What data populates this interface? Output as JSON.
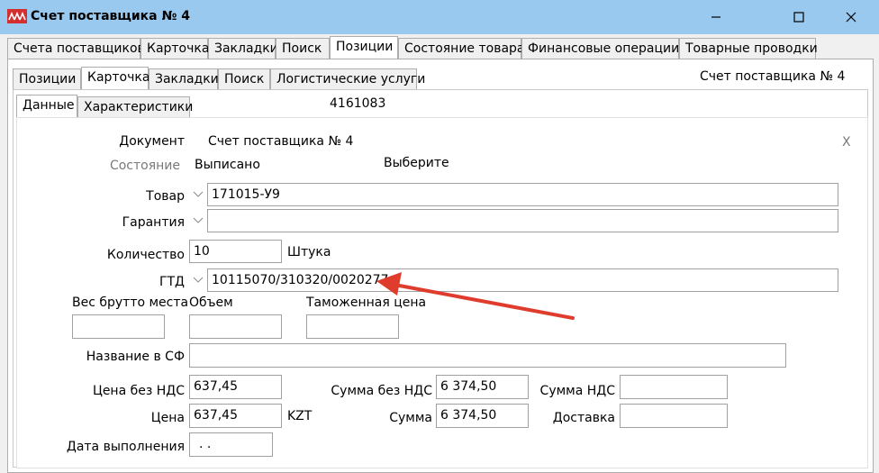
{
  "window": {
    "title": "Счет поставщика № 4",
    "logo_text": "AAA",
    "logo_color": "#d32f2f",
    "minimize_icon": "minimize-icon",
    "maximize_icon": "maximize-icon",
    "close_icon": "close-icon"
  },
  "tabs_top": [
    "Счета поставщиков",
    "Карточка",
    "Закладки",
    "Поиск",
    "Позиции",
    "Состояние товара",
    "Финансовые операции",
    "Товарные проводки"
  ],
  "tabs_second": [
    "Позиции",
    "Карточка",
    "Закладки",
    "Поиск",
    "Логистические услуги"
  ],
  "tabs_third": [
    "Данные",
    "Характеристики"
  ],
  "header_right": "Счет поставщика № 4",
  "record_id": "4161083",
  "form": {
    "document_label": "Документ",
    "document_value": "Счет поставщика № 4",
    "clear_label": "X",
    "state_label": "Состояние",
    "state_value": "Выписано",
    "choose_label": "Выберите",
    "item_label": "Товар",
    "item_value": "171015-У9",
    "warranty_label": "Гарантия",
    "warranty_value": "",
    "qty_label": "Количество",
    "qty_value": "10",
    "unit_value": "Штука",
    "gtd_label": "ГТД",
    "gtd_value": "10115070/310320/0020277",
    "gross_weight_label": "Вес брутто места",
    "gross_weight_value": "",
    "volume_label": "Объем",
    "volume_value": "",
    "customs_price_label": "Таможенная цена",
    "customs_price_value": "",
    "invoice_name_label": "Название в СФ",
    "invoice_name_value": "",
    "price_novat_label": "Цена без НДС",
    "price_novat_value": "637,45",
    "sum_novat_label": "Сумма без НДС",
    "sum_novat_value": "6 374,50",
    "vat_sum_label": "Сумма НДС",
    "vat_sum_value": "",
    "price_label": "Цена",
    "price_value": "637,45",
    "currency_value": "KZT",
    "sum_label": "Сумма",
    "sum_value": "6 374,50",
    "delivery_label": "Доставка",
    "delivery_value": "",
    "completion_date_label": "Дата выполнения",
    "completion_date_value": ". ."
  },
  "annotation": {
    "arrow_color": "#e03c2e",
    "arrow_icon": "red-arrow-annotation"
  },
  "colors": {
    "titlebar": "#99c9ef",
    "window_bg": "#f0f0f0",
    "panel_bg": "#ffffff",
    "border": "#adadad"
  }
}
